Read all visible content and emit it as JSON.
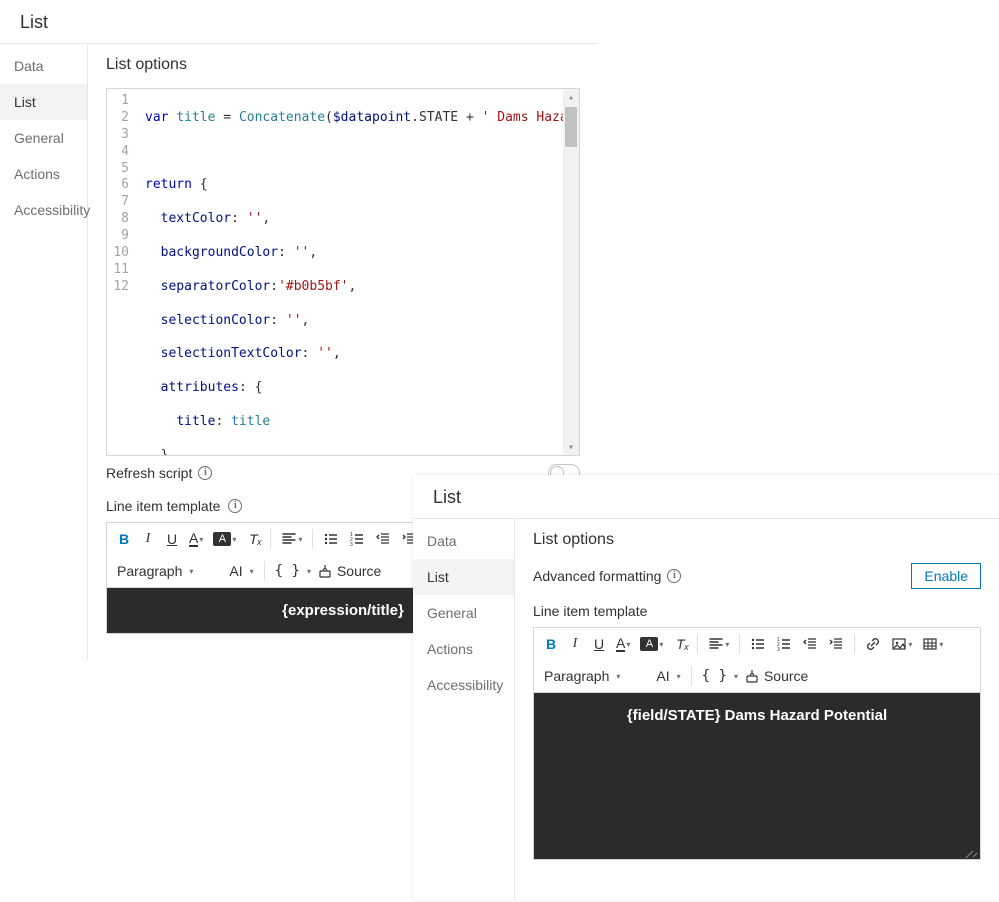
{
  "panelA": {
    "title": "List",
    "sidebar": [
      "Data",
      "List",
      "General",
      "Actions",
      "Accessibility"
    ],
    "activeSidebarIndex": 1,
    "sectionTitle": "List options",
    "refreshLabel": "Refresh script",
    "lineItemLabel": "Line item template",
    "code": {
      "lines": [
        1,
        2,
        3,
        4,
        5,
        6,
        7,
        8,
        9,
        10,
        11,
        12
      ],
      "separatorColorLiteral": "'#b0b5bf'",
      "string1": " Dams Hazard Potentia"
    },
    "toolbar": {
      "paragraph": "Paragraph",
      "ai": "AI",
      "source": "Source"
    },
    "preview": "{expression/title}"
  },
  "panelB": {
    "title": "List",
    "sidebar": [
      "Data",
      "List",
      "General",
      "Actions",
      "Accessibility"
    ],
    "activeSidebarIndex": 1,
    "sectionTitle": "List options",
    "advLabel": "Advanced formatting",
    "enable": "Enable",
    "lineItemLabel": "Line item template",
    "toolbar": {
      "paragraph": "Paragraph",
      "ai": "AI",
      "source": "Source"
    },
    "preview": "{field/STATE} Dams Hazard Potential"
  }
}
